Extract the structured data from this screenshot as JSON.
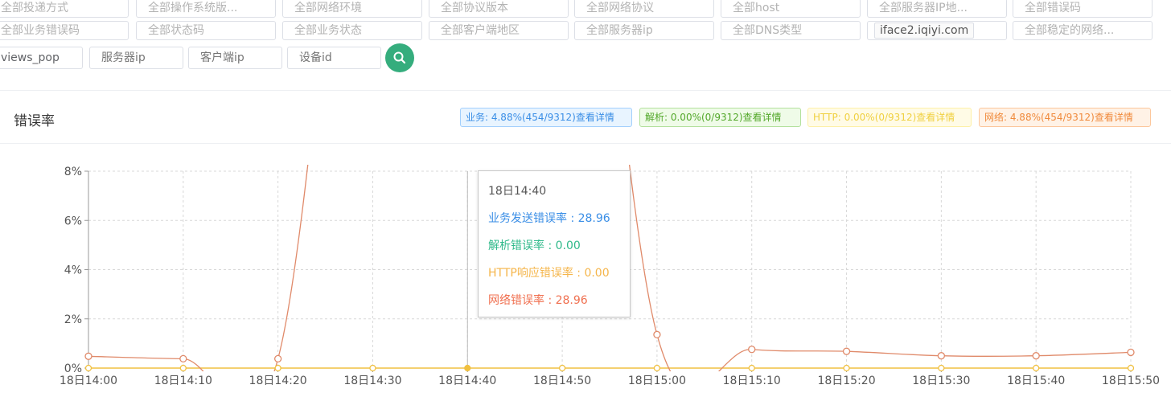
{
  "filters": {
    "row1": [
      "全部投递方式",
      "全部操作系统版...",
      "全部网络环境",
      "全部协议版本",
      "全部网络协议",
      "全部host",
      "全部服务器IP地...",
      "全部错误码"
    ],
    "row2": [
      "全部业务错误码",
      "全部状态码",
      "全部业务状态",
      "全部客户端地区",
      "全部服务器ip",
      "全部DNS类型",
      "iface2.iqiyi.com",
      "全部稳定的网络..."
    ],
    "row3_values": [
      "views_pop"
    ],
    "row3_placeholders": [
      "服务器ip",
      "客户端ip",
      "设备id"
    ]
  },
  "section": {
    "title": "错误率",
    "tags": {
      "business": "业务: 4.88%(454/9312)查看详情",
      "dns": "解析: 0.00%(0/9312)查看详情",
      "http": "HTTP: 0.00%(0/9312)查看详情",
      "network": "网络: 4.88%(454/9312)查看详情"
    }
  },
  "colors": {
    "accent": "#35ad7d",
    "business": "#3a8ee6",
    "dns": "#2fb98a",
    "http": "#f5b54a",
    "network": "#f07050",
    "line": "#e08a6a",
    "flat": "#f0c040"
  },
  "chart_data": {
    "type": "line",
    "x": [
      "18日14:00",
      "18日14:10",
      "18日14:20",
      "18日14:30",
      "18日14:40",
      "18日14:50",
      "18日15:00",
      "18日15:10",
      "18日15:20",
      "18日15:30",
      "18日15:40",
      "18日15:50"
    ],
    "ylim": [
      0,
      8
    ],
    "yticks": [
      "0%",
      "2%",
      "4%",
      "6%",
      "8%"
    ],
    "grid": true,
    "series": [
      {
        "name": "业务发送错误率",
        "values": [
          0.48,
          0.38,
          0.38,
          28.96,
          28.96,
          28.96,
          1.36,
          0.76,
          0.68,
          0.5,
          0.5,
          0.64
        ]
      },
      {
        "name": "解析错误率",
        "values": [
          0,
          0,
          0,
          0,
          0,
          0,
          0,
          0,
          0,
          0,
          0,
          0
        ]
      },
      {
        "name": "HTTP响应错误率",
        "values": [
          0,
          0,
          0,
          0,
          0,
          0,
          0,
          0,
          0,
          0,
          0,
          0
        ]
      },
      {
        "name": "网络错误率",
        "values": [
          0.48,
          0.38,
          0.38,
          28.96,
          28.96,
          28.96,
          1.36,
          0.76,
          0.68,
          0.5,
          0.5,
          0.64
        ]
      }
    ]
  },
  "tooltip": {
    "time": "18日14:40",
    "business": "业务发送错误率 : 28.96",
    "dns": "解析错误率 : 0.00",
    "http": "HTTP响应错误率 : 0.00",
    "network": "网络错误率 : 28.96"
  }
}
